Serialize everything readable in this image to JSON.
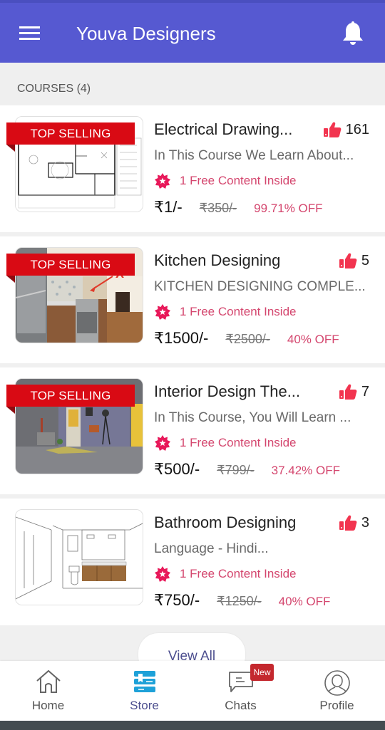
{
  "app": {
    "title": "Youva Designers",
    "accent_color": "#5659d1"
  },
  "section": {
    "label": "COURSES (4)"
  },
  "courses": [
    {
      "title": "Electrical Drawing...",
      "description": "In This Course We Learn About...",
      "likes": "161",
      "ribbon": "TOP SELLING",
      "free_content": "1 Free Content Inside",
      "price": "₹1/-",
      "mrp": "₹350/-",
      "discount": "99.71% OFF",
      "thumbnail": "electrical-floor-plan"
    },
    {
      "title": "Kitchen Designing",
      "description": "KITCHEN DESIGNING COMPLE...",
      "likes": "5",
      "ribbon": "TOP SELLING",
      "free_content": "1 Free Content Inside",
      "price": "₹1500/-",
      "mrp": "₹2500/-",
      "discount": "40% OFF",
      "thumbnail": "kitchen-photo"
    },
    {
      "title": "Interior Design The...",
      "description": "In This Course, You Will Learn ...",
      "likes": "7",
      "ribbon": "TOP SELLING",
      "free_content": "1 Free Content Inside",
      "price": "₹500/-",
      "mrp": "₹799/-",
      "discount": "37.42% OFF",
      "thumbnail": "interior-room"
    },
    {
      "title": "Bathroom Designing",
      "description": "Language -  Hindi...",
      "likes": "3",
      "ribbon": "",
      "free_content": "1 Free Content Inside",
      "price": "₹750/-",
      "mrp": "₹1250/-",
      "discount": "40% OFF",
      "thumbnail": "bathroom-sketch"
    }
  ],
  "view_all_label": "View All",
  "bottom_nav": {
    "items": [
      {
        "label": "Home",
        "icon": "home-icon",
        "active": false
      },
      {
        "label": "Store",
        "icon": "store-icon",
        "active": true
      },
      {
        "label": "Chats",
        "icon": "chat-icon",
        "active": false,
        "badge": "New"
      },
      {
        "label": "Profile",
        "icon": "profile-icon",
        "active": false
      }
    ]
  }
}
